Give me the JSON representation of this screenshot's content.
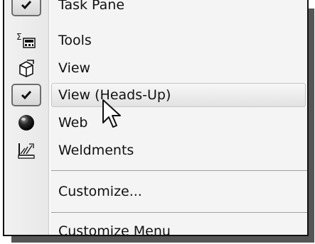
{
  "menu": {
    "items": [
      {
        "label": "Task Pane",
        "checked": true,
        "icon": "check-icon"
      },
      {
        "label": "Tools",
        "icon": "tools-icon"
      },
      {
        "label": "View",
        "icon": "view-cube-icon"
      },
      {
        "label": "View (Heads-Up)",
        "checked": true,
        "highlighted": true,
        "icon": "check-icon"
      },
      {
        "label": "Web",
        "icon": "web-sphere-icon"
      },
      {
        "label": "Weldments",
        "icon": "weldments-icon"
      },
      {
        "label": "Customize..."
      },
      {
        "label": "Customize Menu"
      }
    ]
  },
  "colors": {
    "menu_background": "#f4f4f4",
    "highlight": "#e2e2e2",
    "border": "#111111"
  }
}
